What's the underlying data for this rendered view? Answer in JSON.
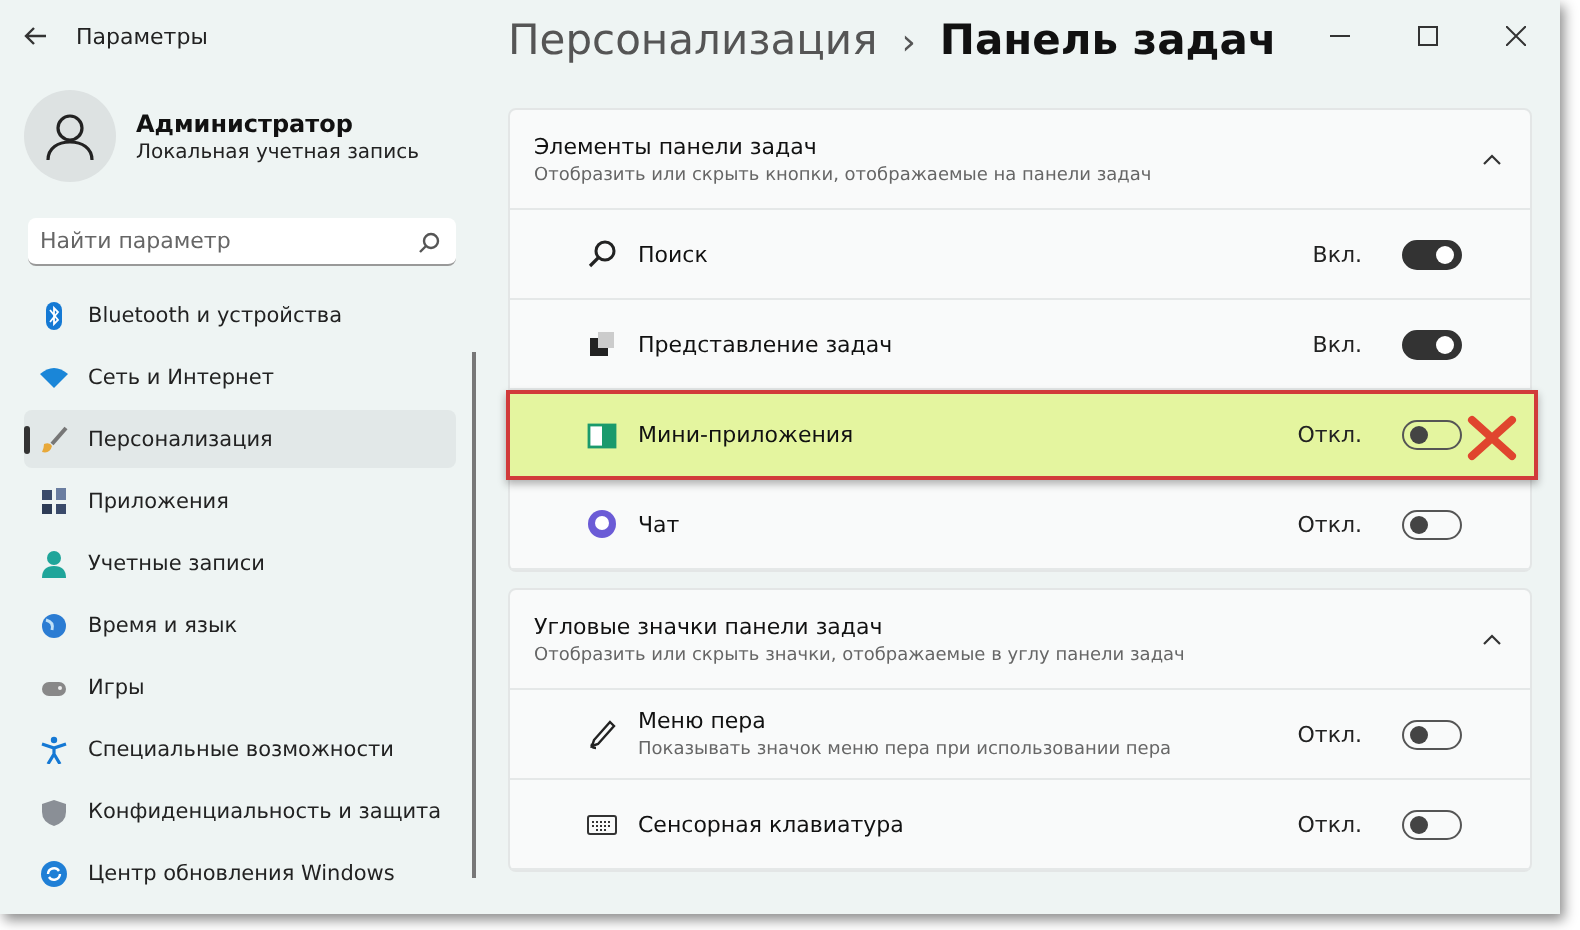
{
  "window": {
    "title": "Параметры"
  },
  "user": {
    "name": "Администратор",
    "account": "Локальная учетная запись"
  },
  "search": {
    "placeholder": "Найти параметр"
  },
  "sidebar": {
    "items": [
      {
        "label": "Bluetooth и устройства",
        "selected": false
      },
      {
        "label": "Сеть и Интернет",
        "selected": false
      },
      {
        "label": "Персонализация",
        "selected": true
      },
      {
        "label": "Приложения",
        "selected": false
      },
      {
        "label": "Учетные записи",
        "selected": false
      },
      {
        "label": "Время и язык",
        "selected": false
      },
      {
        "label": "Игры",
        "selected": false
      },
      {
        "label": "Специальные возможности",
        "selected": false
      },
      {
        "label": "Конфиденциальность и защита",
        "selected": false
      },
      {
        "label": "Центр обновления Windows",
        "selected": false
      }
    ]
  },
  "breadcrumb": {
    "parent": "Персонализация",
    "separator": "›",
    "current": "Панель задач"
  },
  "sections": [
    {
      "title": "Элементы панели задач",
      "subtitle": "Отобразить или скрыть кнопки, отображаемые на панели задач",
      "expanded": true,
      "rows": [
        {
          "label": "Поиск",
          "state": "Вкл.",
          "on": true,
          "highlighted": false
        },
        {
          "label": "Представление задач",
          "state": "Вкл.",
          "on": true,
          "highlighted": false
        },
        {
          "label": "Мини-приложения",
          "state": "Откл.",
          "on": false,
          "highlighted": true
        },
        {
          "label": "Чат",
          "state": "Откл.",
          "on": false,
          "highlighted": false
        }
      ]
    },
    {
      "title": "Угловые значки панели задач",
      "subtitle": "Отобразить или скрыть значки, отображаемые в углу панели задач",
      "expanded": true,
      "rows": [
        {
          "label": "Меню пера",
          "description": "Показывать значок меню пера при использовании пера",
          "state": "Откл.",
          "on": false,
          "highlighted": false
        },
        {
          "label": "Сенсорная клавиатура",
          "state": "Откл.",
          "on": false,
          "highlighted": false
        }
      ]
    }
  ]
}
